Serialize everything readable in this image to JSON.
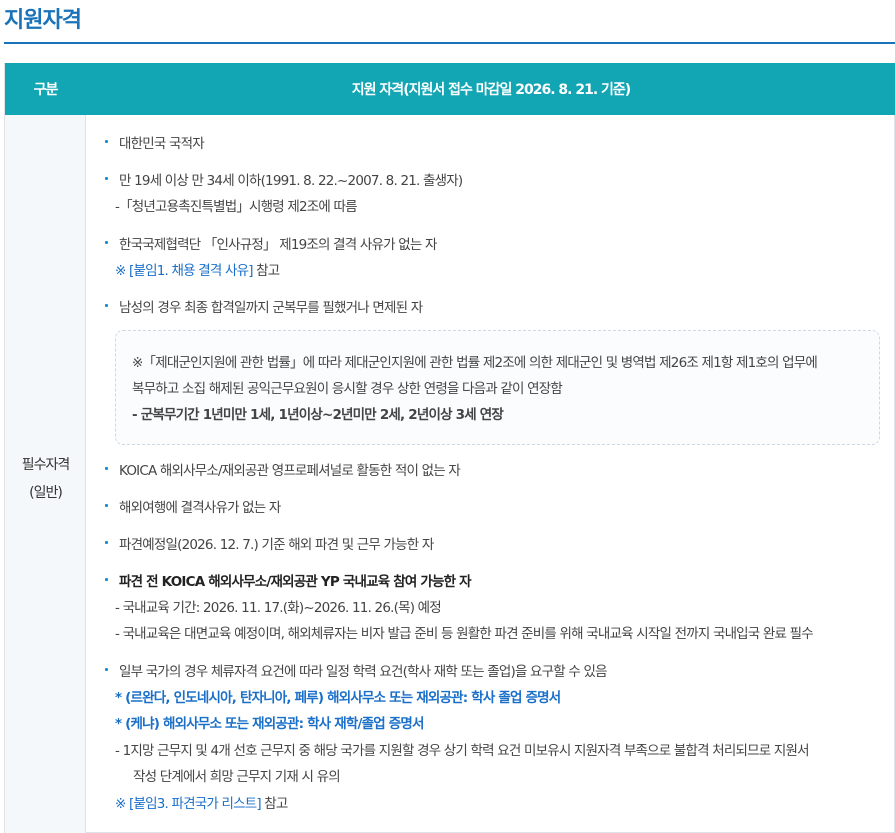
{
  "page_title": "지원자격",
  "table": {
    "header_category": "구분",
    "header_content": "지원 자격(지원서 접수 마감일 2026. 8. 21. 기준)",
    "category_line1": "필수자격",
    "category_line2": "(일반)"
  },
  "items": {
    "i1": "대한민국 국적자",
    "i2": "만 19세 이상 만 34세 이하(1991. 8. 22.~2007. 8. 21. 출생자)",
    "i2_sub": "-「청년고용촉진특별법」시행령 제2조에 따름",
    "i3": "한국국제협력단 「인사규정」 제19조의 결격 사유가 없는 자",
    "i3_note_prefix": "※",
    "i3_note_link": "[붙임1. 채용 결격 사유]",
    "i3_note_suffix": "참고",
    "i4": "남성의 경우 최종 합격일까지 군복무를 필했거나 면제된 자",
    "box_l1": "※「제대군인지원에 관한 법률」에 따라 제대군인지원에 관한 법률 제2조에 의한 제대군인 및 병역법 제26조 제1항 제1호의 업무에",
    "box_l2": "복무하고 소집 해제된 공익근무요원이 응시할 경우 상한 연령을 다음과 같이 연장함",
    "box_l3": "- 군복무기간 1년미만 1세, 1년이상~2년미만 2세, 2년이상 3세 연장",
    "i5": "KOICA 해외사무소/재외공관 영프로페셔널로 활동한 적이 없는 자",
    "i6": "해외여행에 결격사유가 없는 자",
    "i7": "파견예정일(2026. 12. 7.) 기준 해외 파견 및 근무 가능한 자",
    "i8": "파견 전 KOICA 해외사무소/재외공관 YP 국내교육 참여 가능한 자",
    "i8_sub1": "- 국내교육 기간: 2026. 11. 17.(화)~2026. 11. 26.(목) 예정",
    "i8_sub2": "- 국내교육은 대면교육 예정이며, 해외체류자는 비자 발급 준비 등 원활한 파견 준비를 위해 국내교육 시작일 전까지 국내입국 완료 필수",
    "i9": "일부 국가의 경우 체류자격 요건에 따라 일정 학력 요건(학사 재학 또는 졸업)을 요구할 수 있음",
    "i9_sub1": "* (르완다, 인도네시아, 탄자니아, 페루) 해외사무소 또는 재외공관: 학사 졸업 증명서",
    "i9_sub2": "* (케냐) 해외사무소 또는 재외공관: 학사 재학/졸업 증명서",
    "i9_sub3a": "- 1지망 근무지 및 4개 선호 근무지 중 해당 국가를 지원할 경우 상기 학력 요건 미보유시 지원자격 부족으로 불합격 처리되므로 지원서",
    "i9_sub3b": "작성 단계에서 희망 근무지 기재 시 유의",
    "i9_note_prefix": "※",
    "i9_note_link": "[붙임3. 파견국가 리스트]",
    "i9_note_suffix": "참고"
  },
  "colors": {
    "accent": "#1a73b8",
    "header_bg": "#12a5b3",
    "link": "#1a6fc9"
  }
}
